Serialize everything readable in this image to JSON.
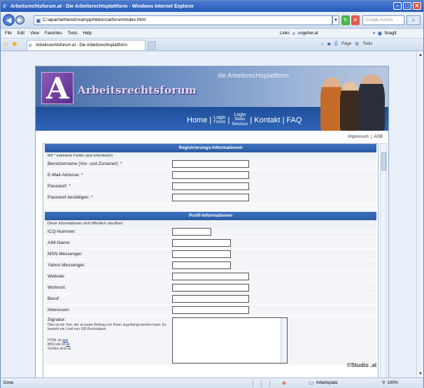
{
  "browser": {
    "title": "Arbeitsrechtsforum.at - Die Arbeitsrechtsplattform - Windows Internet Explorer",
    "url": "C:\\apachefriends\\xampp\\htdocs\\arforum\\index.html",
    "search_placeholder": "Google Austria",
    "menu": [
      "File",
      "Edit",
      "View",
      "Favorites",
      "Tools",
      "Help"
    ],
    "links_label": "Links",
    "links_item": "ungeher.at",
    "snagit_label": "SnagIt",
    "tab_label": "Arbeitsrechtsforum.at - Die Arbeitsrechtsplattform",
    "tools": {
      "page": "Page",
      "tools": "Tools"
    },
    "status_text": "Done",
    "zone_text": "Arbeitsplatz",
    "zoom_text": "100%"
  },
  "site": {
    "title": "Arbeitsrechtsforum",
    "tagline_prefix": "die",
    "tagline": "Arbeitsrechtsplattform",
    "logo_letter": "A",
    "nav": {
      "home": "Home",
      "login_forum_top": "Login",
      "login_forum_bottom": "Forum",
      "login_news_top": "Login",
      "login_news_mid": "News",
      "login_news_bottom": "Services",
      "kontakt": "Kontakt",
      "faq": "FAQ"
    },
    "footer_links": [
      "Impressum",
      "|",
      "AGB"
    ],
    "studio_logo": "©Studio  .at"
  },
  "registration": {
    "header": "Registrierungs-Informationen",
    "note": "Mit * markierte Felder sind erforderlich",
    "fields": [
      {
        "label": "Benutzername (Vor- und Zuname!): *",
        "value": ""
      },
      {
        "label": "E-Mail-Adresse: *",
        "value": ""
      },
      {
        "label": "Passwort: *",
        "value": ""
      },
      {
        "label": "Passwort bestätigen: *",
        "value": ""
      }
    ]
  },
  "profile": {
    "header": "Profil-Informationen",
    "note": "Diese Informationen sind öffentlich abrufbar!",
    "fields": [
      {
        "label": "ICQ-Nummer:",
        "value": ""
      },
      {
        "label": "AIM-Name:",
        "value": ""
      },
      {
        "label": "MSN Messenger:",
        "value": ""
      },
      {
        "label": "Yahoo Messenger:",
        "value": ""
      },
      {
        "label": "Website:",
        "value": ""
      },
      {
        "label": "Wohnort:",
        "value": ""
      },
      {
        "label": "Beruf:",
        "value": ""
      },
      {
        "label": "Interessen:",
        "value": ""
      }
    ],
    "signature": {
      "label": "Signatur:",
      "description": "Dies ist ein Text, der an jeden Beitrag von Ihnen angehängt werden kann. Es besteht ein Limit von 180 Buchstaben.",
      "html_line": "HTML ist",
      "html_value": "aus",
      "bbcode_line": "BBCode ist",
      "bbcode_value": "an",
      "smilies_line": "Smilies sind an"
    }
  },
  "colors": {
    "section_header": "#2b5aa3",
    "header_band": "#1e4f9a",
    "logo": "#6b3a9c"
  }
}
